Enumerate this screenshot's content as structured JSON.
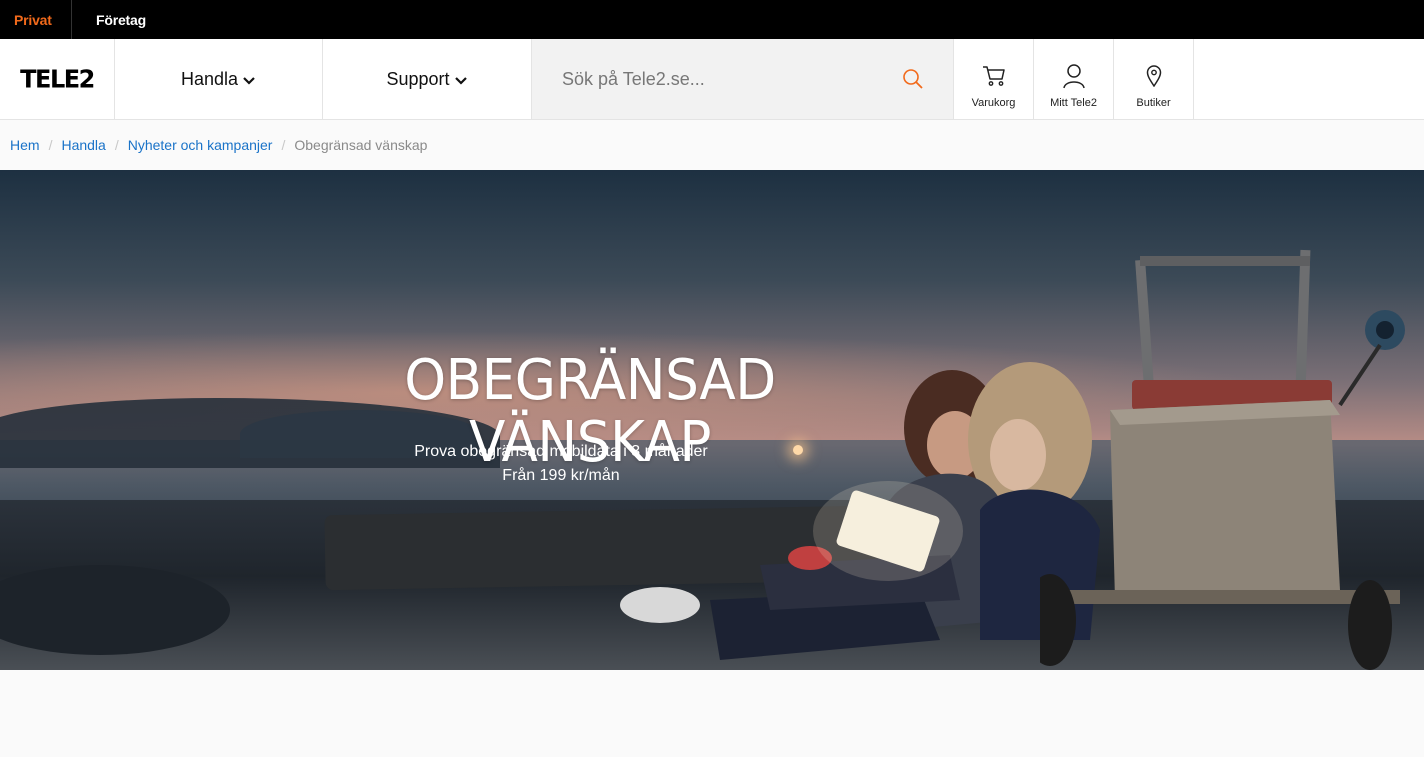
{
  "topbar": {
    "privat": "Privat",
    "foretag": "Företag",
    "accent": "#f26a1b"
  },
  "header": {
    "logo": "TELE2",
    "nav": [
      {
        "label": "Handla"
      },
      {
        "label": "Support"
      }
    ],
    "search": {
      "placeholder": "Sök på Tele2.se...",
      "value": ""
    },
    "buttons": {
      "cart": "Varukorg",
      "account": "Mitt Tele2",
      "stores": "Butiker"
    }
  },
  "breadcrumb": {
    "items": [
      "Hem",
      "Handla",
      "Nyheter och kampanjer"
    ],
    "current": "Obegränsad vänskap",
    "link_color": "#1a73c8"
  },
  "hero": {
    "title": "OBEGRÄNSAD VÄNSKAP",
    "line1": "Prova obegränsad mobildata i 3 månader",
    "line2": "Från 199 kr/mån"
  },
  "icons": {
    "chevron": "chevron-down-icon",
    "search": "search-icon",
    "cart": "cart-icon",
    "user": "user-icon",
    "location": "location-pin-icon"
  }
}
